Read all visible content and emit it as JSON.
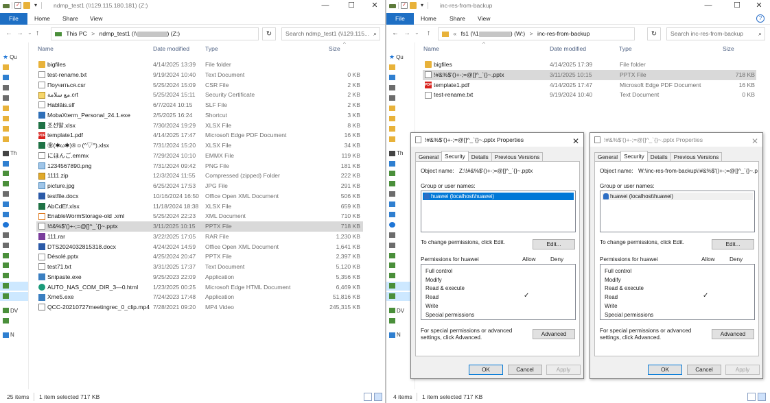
{
  "left": {
    "title": "ndmp_test1 (\\\\129.115.180.181) (Z:)",
    "ribbon_tabs": [
      "File",
      "Home",
      "Share",
      "View"
    ],
    "address": {
      "prefix": "This PC",
      "sep": ">",
      "drive": "ndmp_test1 (\\\\",
      "drive_end": ") (Z:)"
    },
    "search_placeholder": "Search ndmp_test1 (\\\\129.115...",
    "columns": {
      "name": "Name",
      "date": "Date modified",
      "type": "Type",
      "size": "Size"
    },
    "nav": [
      {
        "icon": "star",
        "label": "Qu"
      },
      {
        "icon": "f",
        "label": ""
      },
      {
        "icon": "b",
        "label": ""
      },
      {
        "icon": "n",
        "label": ""
      },
      {
        "icon": "n",
        "label": ""
      },
      {
        "icon": "f",
        "label": ""
      },
      {
        "icon": "f",
        "label": ""
      },
      {
        "icon": "f",
        "label": ""
      },
      {
        "icon": "f",
        "label": ""
      },
      {
        "icon": "d",
        "label": "Th"
      },
      {
        "icon": "b",
        "label": ""
      },
      {
        "icon": "g",
        "label": ""
      },
      {
        "icon": "g",
        "label": ""
      },
      {
        "icon": "n",
        "label": ""
      },
      {
        "icon": "b",
        "label": ""
      },
      {
        "icon": "b",
        "label": ""
      },
      {
        "icon": "m",
        "label": ""
      },
      {
        "icon": "n",
        "label": ""
      },
      {
        "icon": "n",
        "label": ""
      },
      {
        "icon": "g",
        "label": ""
      },
      {
        "icon": "g",
        "label": ""
      },
      {
        "icon": "g",
        "label": ""
      },
      {
        "icon": "g",
        "label": ""
      },
      {
        "icon": "g",
        "label": ""
      },
      {
        "icon": "g",
        "label": "DV"
      },
      {
        "icon": "g",
        "label": ""
      },
      {
        "icon": "b",
        "label": "N"
      }
    ],
    "files": [
      {
        "icon": "folder",
        "name": "bigfiles",
        "date": "4/14/2025 13:39",
        "type": "File folder",
        "size": ""
      },
      {
        "icon": "doc",
        "name": "test-rename.txt",
        "date": "9/19/2024 10:40",
        "type": "Text Document",
        "size": "0 KB"
      },
      {
        "icon": "gen",
        "name": "Поучиться.csr",
        "date": "5/25/2024 15:09",
        "type": "CSR File",
        "size": "2 KB"
      },
      {
        "icon": "cert",
        "name": "مع سلامة.crt",
        "date": "5/25/2024 15:11",
        "type": "Security Certificate",
        "size": "2 KB"
      },
      {
        "icon": "gen",
        "name": "Hablâis.slf",
        "date": "6/7/2024 10:15",
        "type": "SLF File",
        "size": "2 KB"
      },
      {
        "icon": "shortcut",
        "name": "MobaXterm_Personal_24.1.exe",
        "date": "2/5/2025 16:24",
        "type": "Shortcut",
        "size": "3 KB"
      },
      {
        "icon": "xls",
        "name": "조선말.xlsx",
        "date": "7/30/2024 19:29",
        "type": "XLSX File",
        "size": "8 KB"
      },
      {
        "icon": "pdf",
        "name": "template1.pdf",
        "date": "4/14/2025 17:47",
        "type": "Microsoft Edge PDF Document",
        "size": "16 KB"
      },
      {
        "icon": "xls",
        "name": "㊎(✱ω✱)®☺(^▽^).xlsx",
        "date": "7/31/2024 15:20",
        "type": "XLSX File",
        "size": "34 KB"
      },
      {
        "icon": "gen",
        "name": "にほんご.emmx",
        "date": "7/29/2024 10:10",
        "type": "EMMX File",
        "size": "119 KB"
      },
      {
        "icon": "img",
        "name": "1234567890.png",
        "date": "7/31/2024 09:42",
        "type": "PNG File",
        "size": "181 KB"
      },
      {
        "icon": "zip",
        "name": "1111.zip",
        "date": "12/3/2024 11:55",
        "type": "Compressed (zipped) Folder",
        "size": "222 KB"
      },
      {
        "icon": "img",
        "name": "picture.jpg",
        "date": "6/25/2024 17:53",
        "type": "JPG File",
        "size": "291 KB"
      },
      {
        "icon": "word",
        "name": "testfile.docx",
        "date": "10/16/2024 16:50",
        "type": "Office Open XML Document",
        "size": "506 KB"
      },
      {
        "icon": "xls",
        "name": "AbCdEf.xlsx",
        "date": "11/18/2024 18:38",
        "type": "XLSX File",
        "size": "659 KB"
      },
      {
        "icon": "xml",
        "name": "EnableWormStorage-old .xml",
        "date": "5/25/2024 22:23",
        "type": "XML Document",
        "size": "710 KB"
      },
      {
        "icon": "ppt",
        "name": "!#&%$'()+-;=@[]^_`{}~.pptx",
        "date": "3/11/2025 10:15",
        "type": "PPTX File",
        "size": "718 KB",
        "selected": true
      },
      {
        "icon": "rar",
        "name": "111.rar",
        "date": "3/22/2025 17:05",
        "type": "RAR File",
        "size": "1,230 KB"
      },
      {
        "icon": "word",
        "name": "DTS2024032815318.docx",
        "date": "4/24/2024 14:59",
        "type": "Office Open XML Document",
        "size": "1,641 KB"
      },
      {
        "icon": "ppt",
        "name": "Désolé.pptx",
        "date": "4/25/2024 20:47",
        "type": "PPTX File",
        "size": "2,397 KB"
      },
      {
        "icon": "doc",
        "name": "test71.txt",
        "date": "3/31/2025 17:37",
        "type": "Text Document",
        "size": "5,120 KB"
      },
      {
        "icon": "exe",
        "name": "Snipaste.exe",
        "date": "9/25/2023 22:09",
        "type": "Application",
        "size": "5,356 KB"
      },
      {
        "icon": "edge",
        "name": "AUTO_NAS_COM_DIR_3---0.html",
        "date": "1/23/2025 00:25",
        "type": "Microsoft Edge HTML Document",
        "size": "6,469 KB"
      },
      {
        "icon": "exe",
        "name": "Xme5.exe",
        "date": "7/24/2023 17:48",
        "type": "Application",
        "size": "51,816 KB"
      },
      {
        "icon": "mp4",
        "name": "QCC-20210727meetingrec_0_clip.mp4",
        "date": "7/28/2021 09:20",
        "type": "MP4 Video",
        "size": "245,315 KB"
      }
    ],
    "status": {
      "count": "25 items",
      "selected": "1 item selected  717 KB"
    }
  },
  "right": {
    "title": "inc-res-from-backup",
    "ribbon_tabs": [
      "File",
      "Home",
      "Share",
      "View"
    ],
    "address": {
      "chev": "«",
      "drive": "fs1 (\\\\1",
      "drive_end": ") (W:)",
      "sep": ">",
      "folder": "inc-res-from-backup"
    },
    "search_placeholder": "Search inc-res-from-backup",
    "columns": {
      "name": "Name",
      "date": "Date modified",
      "type": "Type",
      "size": "Size"
    },
    "nav": [
      {
        "icon": "star",
        "label": "Qu"
      },
      {
        "icon": "f",
        "label": ""
      },
      {
        "icon": "b",
        "label": ""
      },
      {
        "icon": "n",
        "label": ""
      },
      {
        "icon": "n",
        "label": ""
      },
      {
        "icon": "f",
        "label": ""
      },
      {
        "icon": "f",
        "label": ""
      },
      {
        "icon": "f",
        "label": ""
      },
      {
        "icon": "f",
        "label": ""
      },
      {
        "icon": "d",
        "label": "Th"
      },
      {
        "icon": "b",
        "label": ""
      },
      {
        "icon": "g",
        "label": ""
      },
      {
        "icon": "g",
        "label": ""
      },
      {
        "icon": "n",
        "label": ""
      },
      {
        "icon": "b",
        "label": ""
      },
      {
        "icon": "b",
        "label": ""
      },
      {
        "icon": "m",
        "label": ""
      },
      {
        "icon": "n",
        "label": ""
      },
      {
        "icon": "n",
        "label": ""
      },
      {
        "icon": "g",
        "label": ""
      },
      {
        "icon": "g",
        "label": ""
      },
      {
        "icon": "g",
        "label": ""
      },
      {
        "icon": "g",
        "label": ""
      },
      {
        "icon": "g",
        "label": ""
      },
      {
        "icon": "g",
        "label": "DV"
      },
      {
        "icon": "g",
        "label": ""
      },
      {
        "icon": "b",
        "label": "N"
      }
    ],
    "files": [
      {
        "icon": "folder",
        "name": "bigfiles",
        "date": "4/14/2025 17:39",
        "type": "File folder",
        "size": ""
      },
      {
        "icon": "ppt",
        "name": "!#&%$'()+-;=@[]^_`{}~.pptx",
        "date": "3/11/2025 10:15",
        "type": "PPTX File",
        "size": "718 KB",
        "selected": true
      },
      {
        "icon": "pdf",
        "name": "template1.pdf",
        "date": "4/14/2025 17:47",
        "type": "Microsoft Edge PDF Document",
        "size": "16 KB"
      },
      {
        "icon": "doc",
        "name": "test-rename.txt",
        "date": "9/19/2024 10:40",
        "type": "Text Document",
        "size": "0 KB"
      }
    ],
    "status": {
      "count": "4 items",
      "selected": "1 item selected  717 KB"
    }
  },
  "dialogs": [
    {
      "title": "!#&%$'()+-;=@[]^_`{}~.pptx Properties",
      "tabs": [
        "General",
        "Security",
        "Details",
        "Previous Versions"
      ],
      "object_label": "Object name:",
      "object_value": "Z:\\!#&%$'()+-;=@[]^_`{}~.pptx",
      "group_label": "Group or user names:",
      "user": "huawei (localhost\\huawei)",
      "change_text": "To change permissions, click Edit.",
      "edit_label": "Edit...",
      "perm_header": "Permissions for huawei",
      "allow": "Allow",
      "deny": "Deny",
      "permissions": [
        {
          "name": "Full control",
          "allow": ""
        },
        {
          "name": "Modify",
          "allow": ""
        },
        {
          "name": "Read & execute",
          "allow": ""
        },
        {
          "name": "Read",
          "allow": "✓"
        },
        {
          "name": "Write",
          "allow": ""
        },
        {
          "name": "Special permissions",
          "allow": ""
        }
      ],
      "special_text": "For special permissions or advanced settings, click Advanced.",
      "advanced_label": "Advanced",
      "ok": "OK",
      "cancel": "Cancel",
      "apply": "Apply",
      "close": "✕"
    },
    {
      "title": "!#&%$'()+-;=@[]^_`{}~.pptx Properties",
      "tabs": [
        "General",
        "Security",
        "Details",
        "Previous Versions"
      ],
      "object_label": "Object name:",
      "object_value": "W:\\inc-res-from-backup\\!#&%$'()+-;=@[]^_`{}~.ppt",
      "group_label": "Group or user names:",
      "user": "huawei (localhost\\huawei)",
      "change_text": "To change permissions, click Edit.",
      "edit_label": "Edit...",
      "perm_header": "Permissions for huawei",
      "allow": "Allow",
      "deny": "Deny",
      "permissions": [
        {
          "name": "Full control",
          "allow": ""
        },
        {
          "name": "Modify",
          "allow": ""
        },
        {
          "name": "Read & execute",
          "allow": ""
        },
        {
          "name": "Read",
          "allow": "✓"
        },
        {
          "name": "Write",
          "allow": ""
        },
        {
          "name": "Special permissions",
          "allow": ""
        }
      ],
      "special_text": "For special permissions or advanced settings, click Advanced.",
      "advanced_label": "Advanced",
      "ok": "OK",
      "cancel": "Cancel",
      "apply": "Apply",
      "close": "✕"
    }
  ],
  "controls": {
    "minimize": "—",
    "maximize": "☐",
    "close": "✕",
    "help": "?",
    "back": "←",
    "forward": "→",
    "recent": "⌄",
    "up": "↑",
    "refresh": "↻",
    "search_icon": "⌕",
    "sort_caret": "^"
  }
}
